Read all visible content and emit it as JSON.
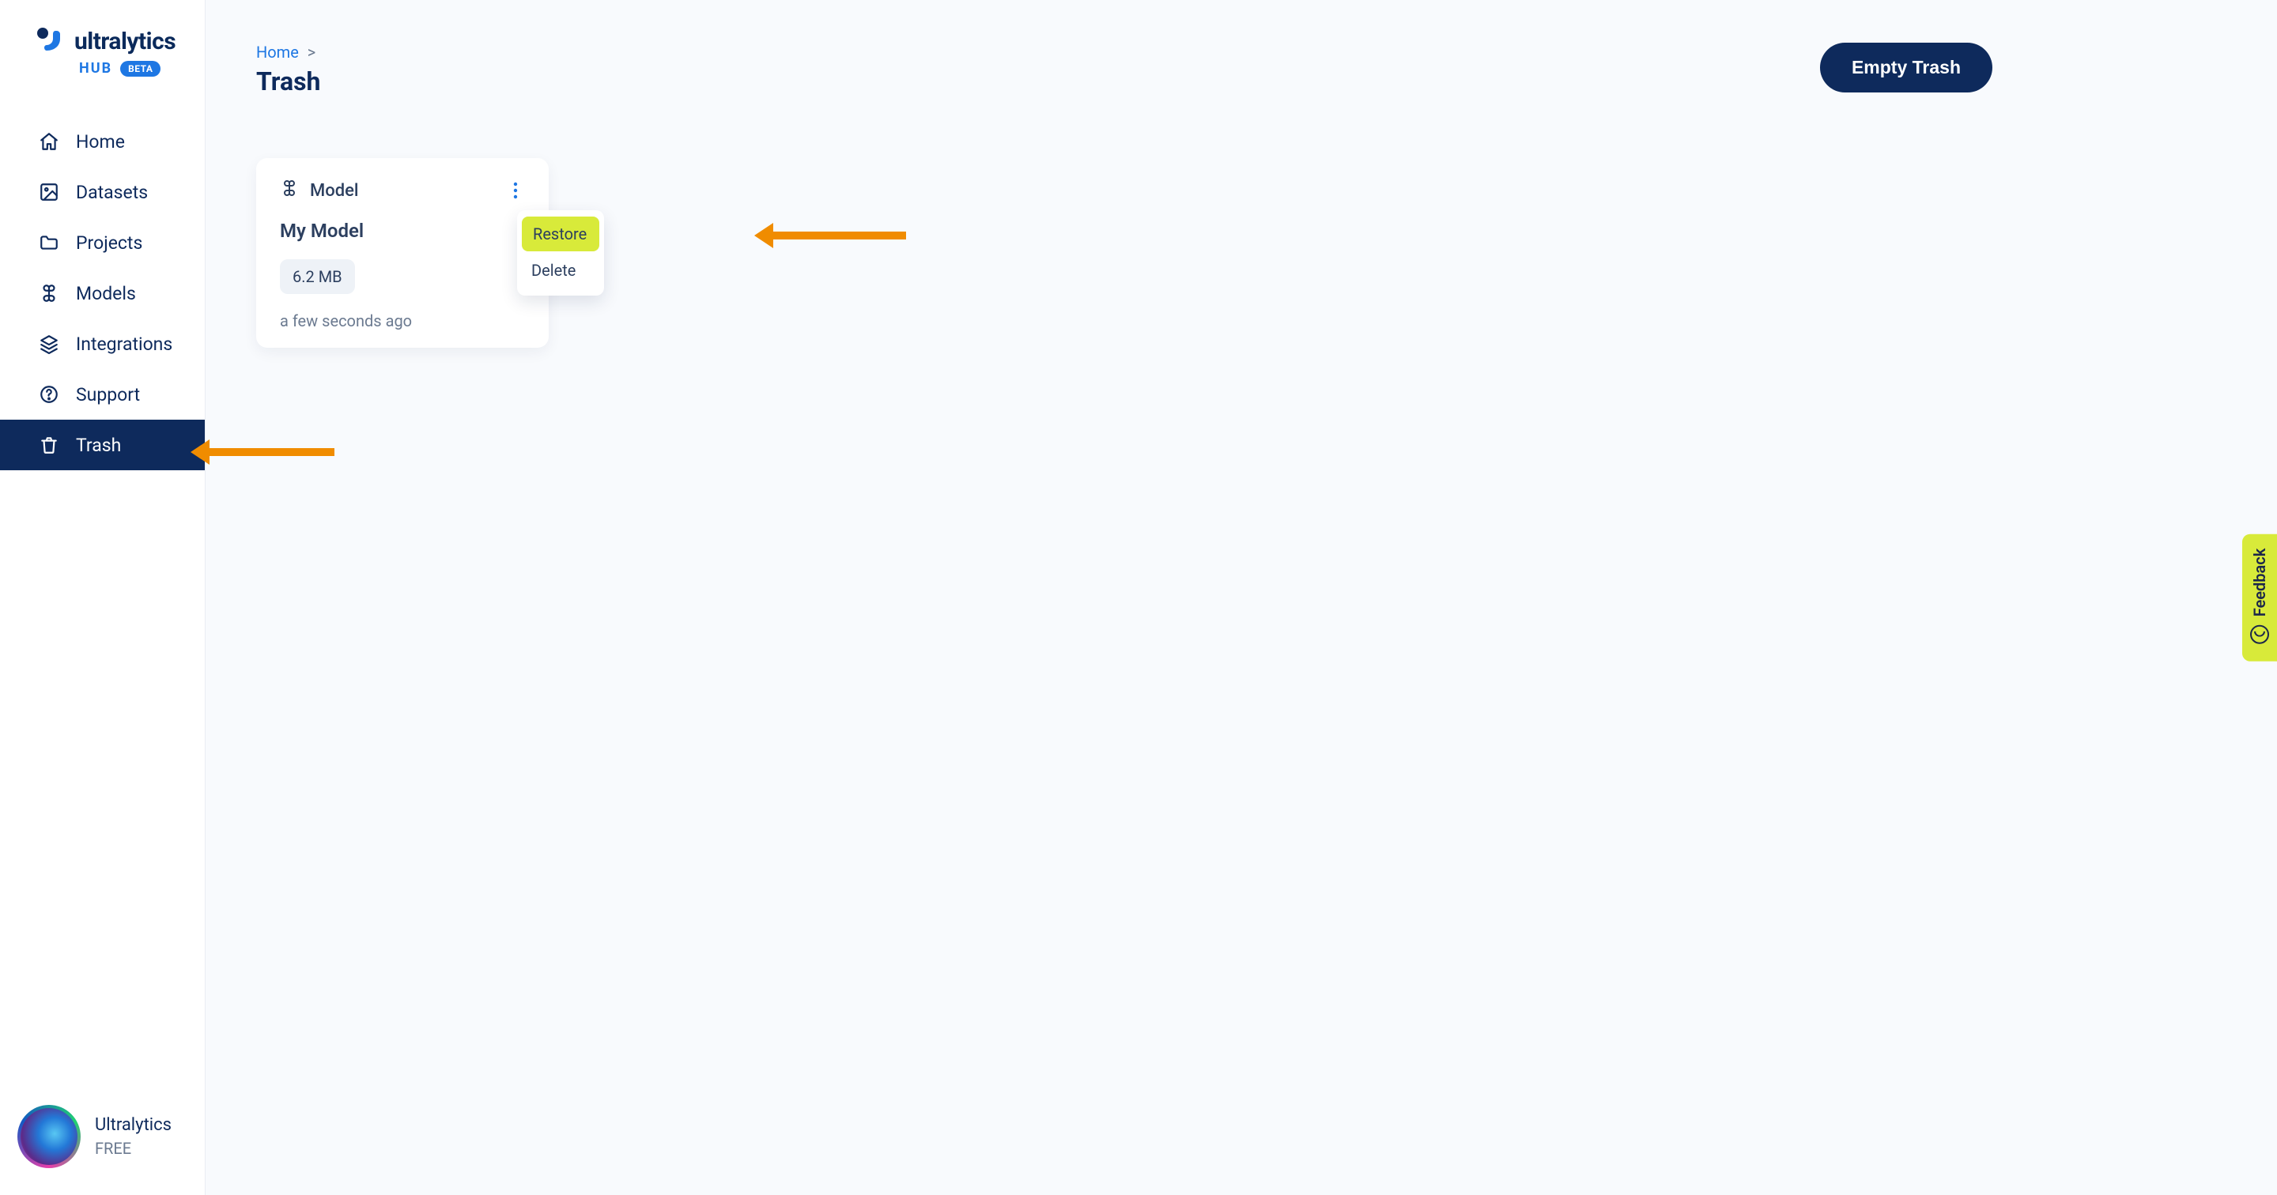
{
  "brand": {
    "name": "ultralytics",
    "sub": "HUB",
    "badge": "BETA"
  },
  "sidebar": {
    "items": [
      {
        "label": "Home"
      },
      {
        "label": "Datasets"
      },
      {
        "label": "Projects"
      },
      {
        "label": "Models"
      },
      {
        "label": "Integrations"
      },
      {
        "label": "Support"
      },
      {
        "label": "Trash"
      }
    ]
  },
  "user": {
    "name": "Ultralytics",
    "plan": "FREE"
  },
  "breadcrumb": {
    "home": "Home",
    "sep": ">"
  },
  "page": {
    "title": "Trash"
  },
  "actions": {
    "empty": "Empty Trash"
  },
  "card": {
    "type": "Model",
    "title": "My Model",
    "size": "6.2 MB",
    "ago": "a few seconds ago"
  },
  "menu": {
    "restore": "Restore",
    "delete": "Delete"
  },
  "feedback": {
    "label": "Feedback"
  }
}
